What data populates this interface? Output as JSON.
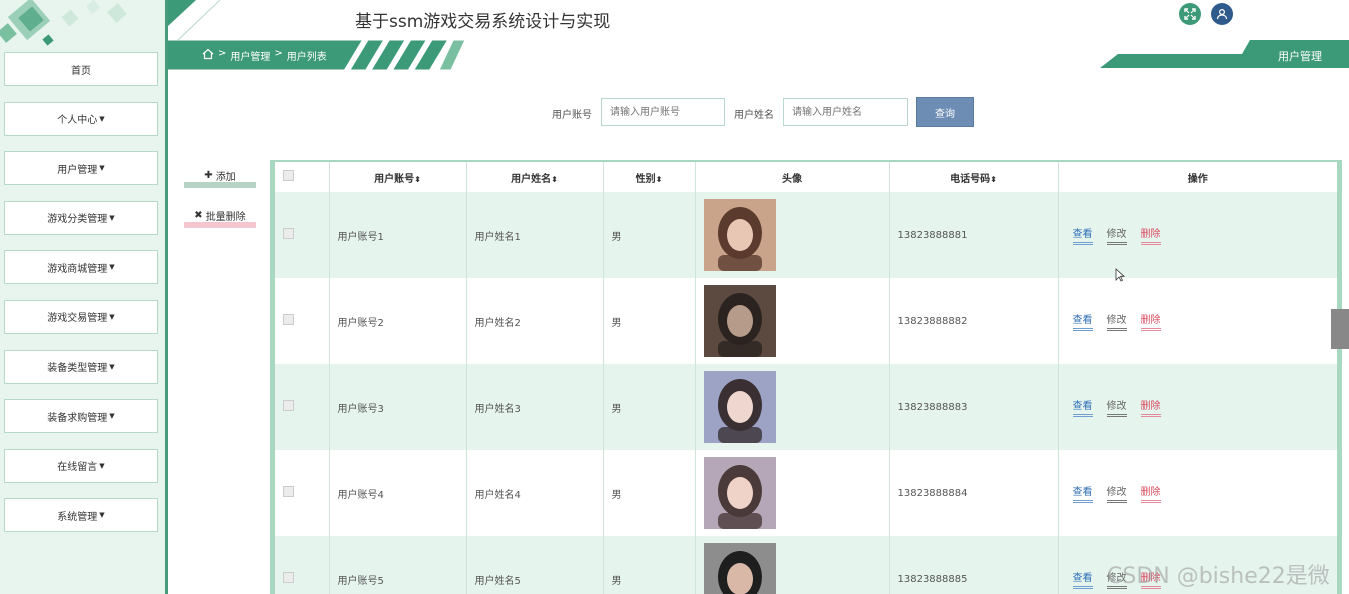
{
  "header": {
    "title": "基于ssm游戏交易系统设计与实现",
    "right_tab": "用户管理"
  },
  "breadcrumb": [
    "用户管理",
    "用户列表"
  ],
  "sidebar": {
    "items": [
      {
        "label": "首页",
        "dropdown": false
      },
      {
        "label": "个人中心",
        "dropdown": true
      },
      {
        "label": "用户管理",
        "dropdown": true
      },
      {
        "label": "游戏分类管理",
        "dropdown": true
      },
      {
        "label": "游戏商城管理",
        "dropdown": true
      },
      {
        "label": "游戏交易管理",
        "dropdown": true
      },
      {
        "label": "装备类型管理",
        "dropdown": true
      },
      {
        "label": "装备求购管理",
        "dropdown": true
      },
      {
        "label": "在线留言",
        "dropdown": true
      },
      {
        "label": "系统管理",
        "dropdown": true
      }
    ]
  },
  "search": {
    "account_label": "用户账号",
    "account_placeholder": "请输入用户账号",
    "name_label": "用户姓名",
    "name_placeholder": "请输入用户姓名",
    "button": "查询"
  },
  "actions": {
    "add": "添加",
    "batch_delete": "批量删除"
  },
  "table": {
    "columns": [
      "用户账号",
      "用户姓名",
      "性别",
      "头像",
      "电话号码",
      "操作"
    ],
    "sortable": [
      true,
      true,
      true,
      false,
      true,
      false
    ],
    "rows": [
      {
        "account": "用户账号1",
        "name": "用户姓名1",
        "gender": "男",
        "phone": "13823888881"
      },
      {
        "account": "用户账号2",
        "name": "用户姓名2",
        "gender": "男",
        "phone": "13823888882"
      },
      {
        "account": "用户账号3",
        "name": "用户姓名3",
        "gender": "男",
        "phone": "13823888883"
      },
      {
        "account": "用户账号4",
        "name": "用户姓名4",
        "gender": "男",
        "phone": "13823888884"
      },
      {
        "account": "用户账号5",
        "name": "用户姓名5",
        "gender": "男",
        "phone": "13823888885"
      }
    ],
    "ops": {
      "view": "查看",
      "edit": "修改",
      "delete": "删除"
    }
  },
  "watermark": "CSDN @bishe22是微",
  "colors": {
    "accent": "#3d9a78",
    "search_button": "#6e8db5",
    "danger": "#d94a5e",
    "link": "#2f6fb5"
  }
}
